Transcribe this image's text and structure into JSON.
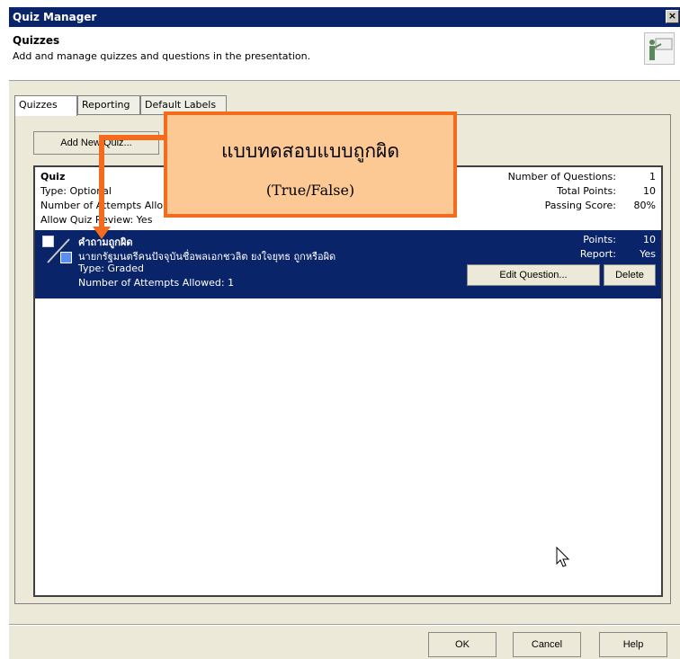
{
  "window": {
    "title": "Quiz Manager",
    "close_glyph": "×"
  },
  "header": {
    "title": "Quizzes",
    "subtitle": "Add and manage quizzes and questions in the presentation.",
    "icon": "presenter-icon"
  },
  "tabs": [
    {
      "label": "Quizzes",
      "active": true
    },
    {
      "label": "Reporting",
      "active": false
    },
    {
      "label": "Default Labels",
      "active": false
    }
  ],
  "toolbar": {
    "add_quiz_label": "Add New Quiz..."
  },
  "quiz": {
    "name": "Quiz",
    "type": "Type: Optional",
    "attempts": "Number of Attempts Allo",
    "review": "Allow Quiz Review: Yes",
    "questions_label": "Number of Questions:",
    "questions_value": "1",
    "points_label": "Total Points:",
    "points_value": "10",
    "passing_label": "Passing Score:",
    "passing_value": "80%"
  },
  "question": {
    "title": "คำถามถูกผิด",
    "text": "นายกรัฐมนตรีคนปัจจุบันชื่อพลเอกชวลิต ยงใจยุทธ ถูกหรือผิด",
    "type": "Type: Graded",
    "attempts": "Number of Attempts Allowed: 1",
    "points_label": "Points:",
    "points_value": "10",
    "report_label": "Report:",
    "report_value": "Yes",
    "edit_label": "Edit Question...",
    "delete_label": "Delete"
  },
  "callout": {
    "main": "แบบทดสอบแบบถูกผิด",
    "sub": "(True/False)",
    "accent": "#f36c1e",
    "fill": "#fcc995"
  },
  "footer": {
    "ok": "OK",
    "cancel": "Cancel",
    "help": "Help"
  }
}
